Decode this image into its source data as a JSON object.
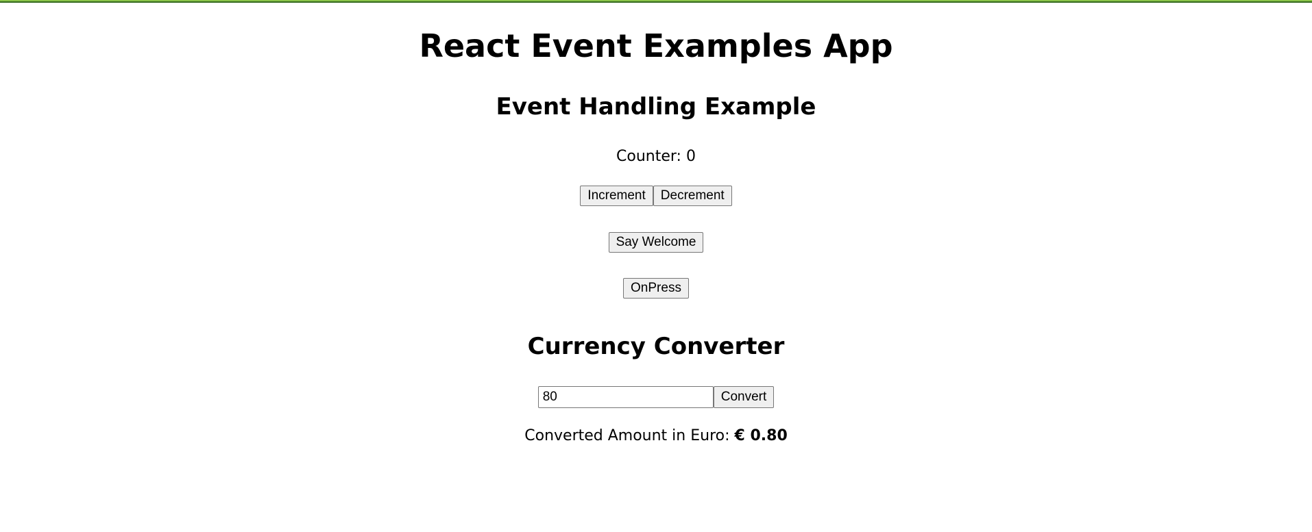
{
  "app": {
    "title": "React Event Examples App"
  },
  "event_section": {
    "title": "Event Handling Example",
    "counter_label": "Counter: ",
    "counter_value": "0",
    "increment_label": "Increment",
    "decrement_label": "Decrement",
    "welcome_label": "Say Welcome",
    "onpress_label": "OnPress"
  },
  "currency_section": {
    "title": "Currency Converter",
    "amount_value": "80",
    "convert_label": "Convert",
    "result_label": "Converted Amount in Euro: ",
    "result_value": "€ 0.80"
  },
  "colors": {
    "top_border_light": "#8bc34a",
    "top_border_dark": "#33691e",
    "button_bg": "#efefef",
    "button_border": "#767676"
  }
}
